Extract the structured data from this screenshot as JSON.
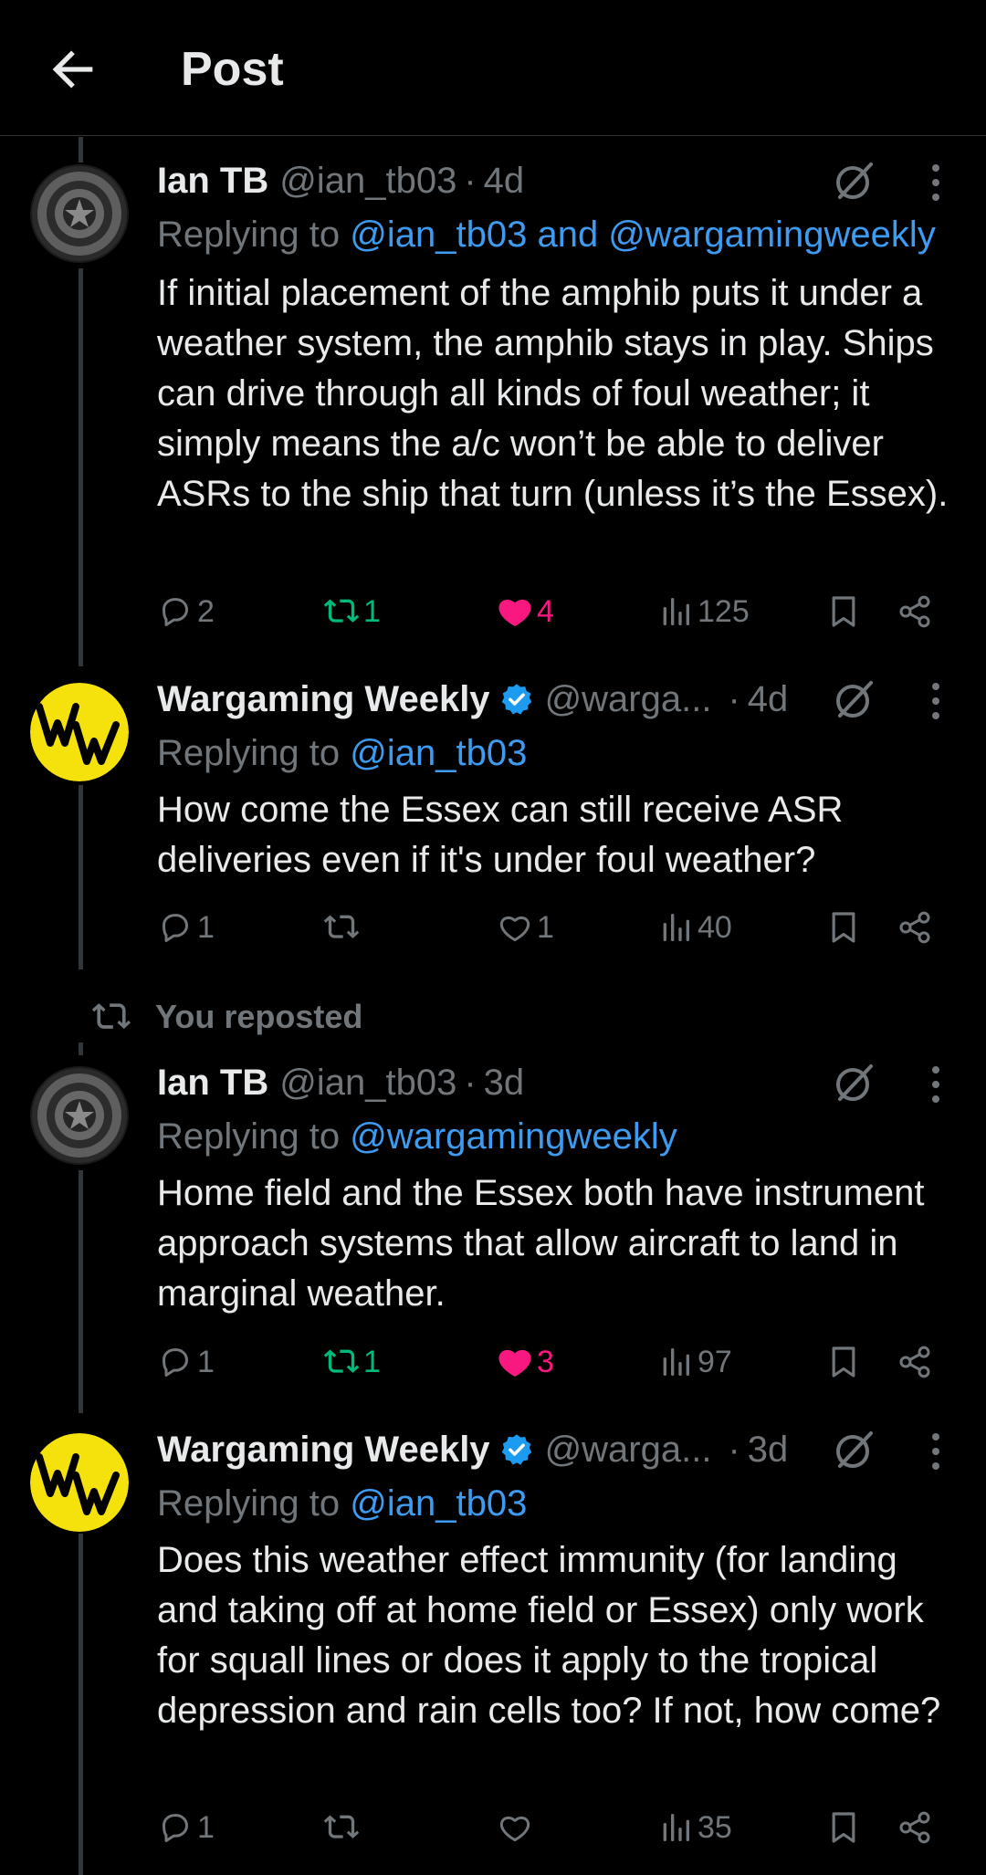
{
  "header": {
    "title": "Post"
  },
  "colors": {
    "accent": "#1d9bf0",
    "mention": "#3e9bf0",
    "repost": "#00ba7c",
    "like": "#f91880",
    "muted": "#71767b"
  },
  "tweets": [
    {
      "name": "Ian TB",
      "handle": "@ian_tb03",
      "dot": "·",
      "time": "4d",
      "verified": false,
      "avatar": "shield-avatar",
      "reply_prefix": "Replying to",
      "reply_to": "@ian_tb03 and @wargamingweekly",
      "text": "If initial placement of the amphib puts it under a weather system, the amphib stays in play. Ships can drive through all kinds of foul weather; it simply means the a/c won’t be able to deliver ASRs to the ship that turn (unless it’s the Essex).",
      "replies": "2",
      "reposts": "1",
      "likes": "4",
      "views": "125",
      "reposted": true,
      "liked": true
    },
    {
      "name": "Wargaming Weekly",
      "handle": "@warga...",
      "dot": "·",
      "time": "4d",
      "verified": true,
      "avatar": "ww-avatar",
      "reply_prefix": "Replying to",
      "reply_to": "@ian_tb03",
      "text": "How come the Essex can still receive ASR deliveries even if it's under foul weather?",
      "replies": "1",
      "reposts": "",
      "likes": "1",
      "views": "40",
      "reposted": false,
      "liked": false
    },
    {
      "name": "Ian TB",
      "handle": "@ian_tb03",
      "dot": "·",
      "time": "3d",
      "verified": false,
      "avatar": "shield-avatar",
      "reply_prefix": "Replying to",
      "reply_to": "@wargamingweekly",
      "text": "Home field and the Essex both have instrument approach systems that allow aircraft to land in marginal weather.",
      "replies": "1",
      "reposts": "1",
      "likes": "3",
      "views": "97",
      "reposted": true,
      "liked": true
    },
    {
      "name": "Wargaming Weekly",
      "handle": "@warga...",
      "dot": "·",
      "time": "3d",
      "verified": true,
      "avatar": "ww-avatar",
      "reply_prefix": "Replying to",
      "reply_to": "@ian_tb03",
      "text": "Does this weather effect immunity (for landing and taking off at home field or Essex) only work for squall lines or does it apply to the tropical depression and rain cells too? If not, how come?",
      "replies": "1",
      "reposts": "",
      "likes": "",
      "views": "35",
      "reposted": false,
      "liked": false
    }
  ],
  "repost_banner": {
    "label": "You reposted"
  },
  "avatars": {
    "ww_logo_text": "WW"
  }
}
